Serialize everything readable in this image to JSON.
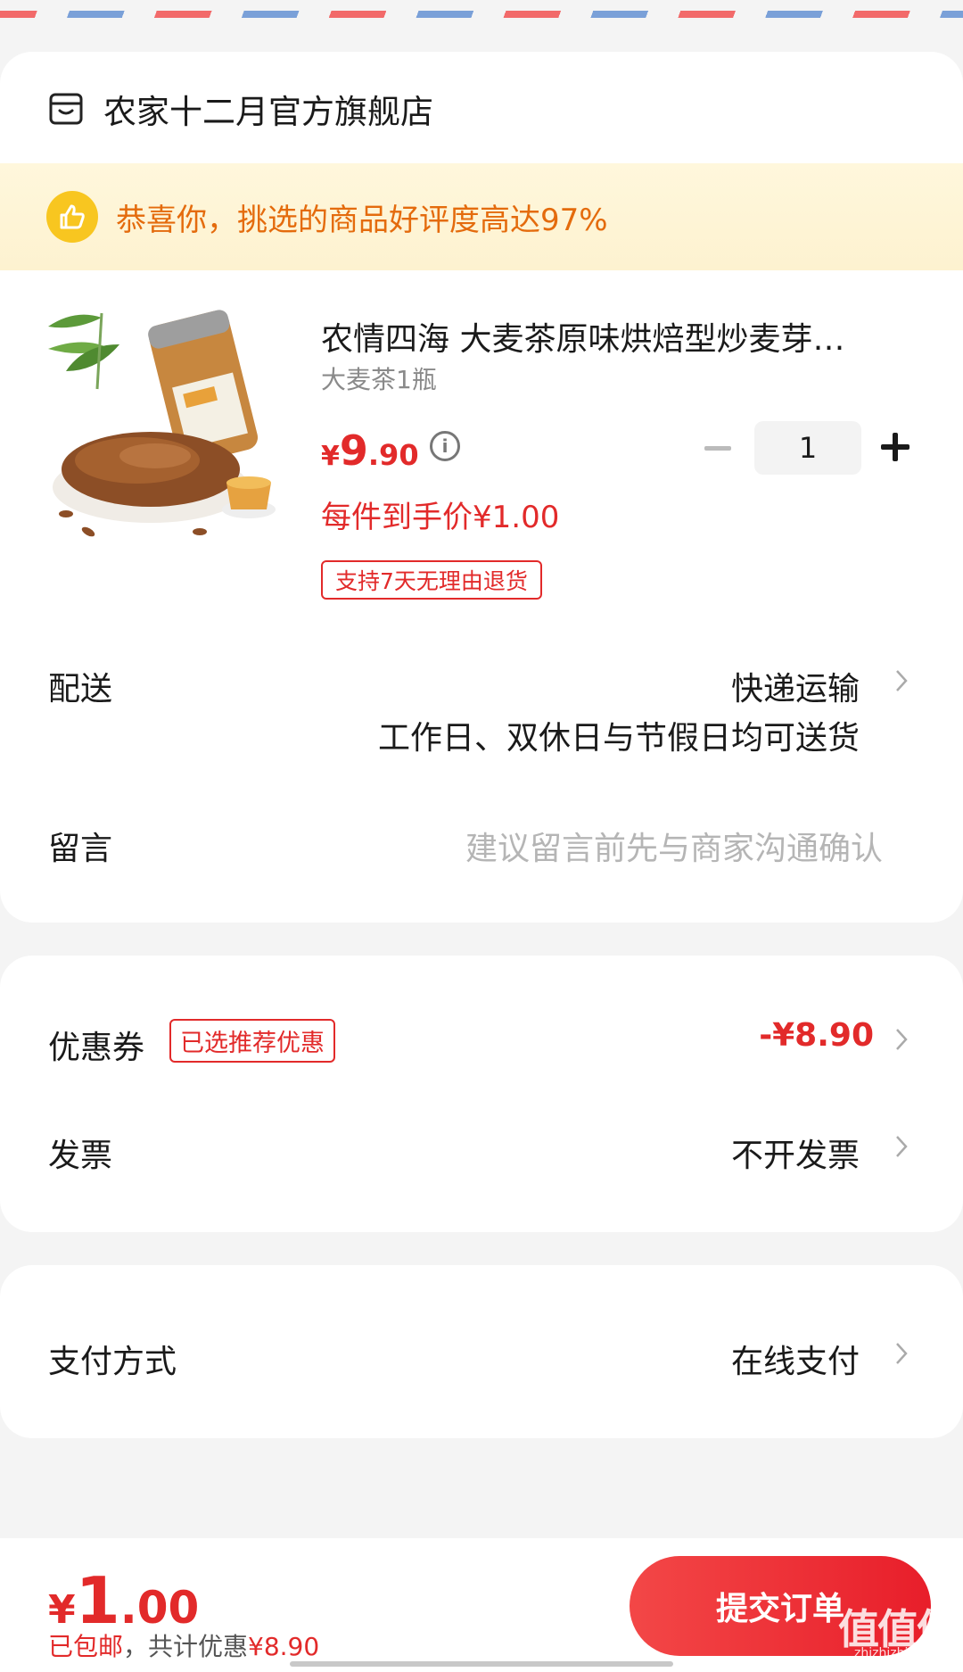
{
  "shop": {
    "name": "农家十二月官方旗舰店",
    "icon": "store-icon"
  },
  "praise": {
    "icon": "thumbs-up-icon",
    "text": "恭喜你，挑选的商品好评度高达97%"
  },
  "product": {
    "title": "农情四海 大麦茶原味烘焙型炒麦芽…",
    "spec": "大麦茶1瓶",
    "price_symbol": "¥",
    "price_int": "9",
    "price_dec": ".90",
    "info_icon": "info-icon",
    "unit_price": "每件到手价¥1.00",
    "return_badge": "支持7天无理由退货",
    "quantity": "1"
  },
  "delivery": {
    "label": "配送",
    "value": "快递运输",
    "note": "工作日、双休日与节假日均可送货"
  },
  "message": {
    "label": "留言",
    "placeholder": "建议留言前先与商家沟通确认"
  },
  "coupon": {
    "label": "优惠券",
    "badge": "已选推荐优惠",
    "value": "-¥8.90"
  },
  "invoice": {
    "label": "发票",
    "value": "不开发票"
  },
  "payment": {
    "label": "支付方式",
    "value": "在线支付"
  },
  "footer": {
    "total_symbol": "¥",
    "total_int": "1",
    "total_dec": ".00",
    "free_shipping": "已包邮",
    "separator": "，共计优惠",
    "saved": "¥8.90",
    "submit_label": "提交订单",
    "watermark": "值值值",
    "watermark_url": "zhizhizhi.com"
  },
  "colors": {
    "accent_red": "#e22a2a",
    "banner_orange": "#e46b0d",
    "banner_bg": "#fff7dc"
  }
}
